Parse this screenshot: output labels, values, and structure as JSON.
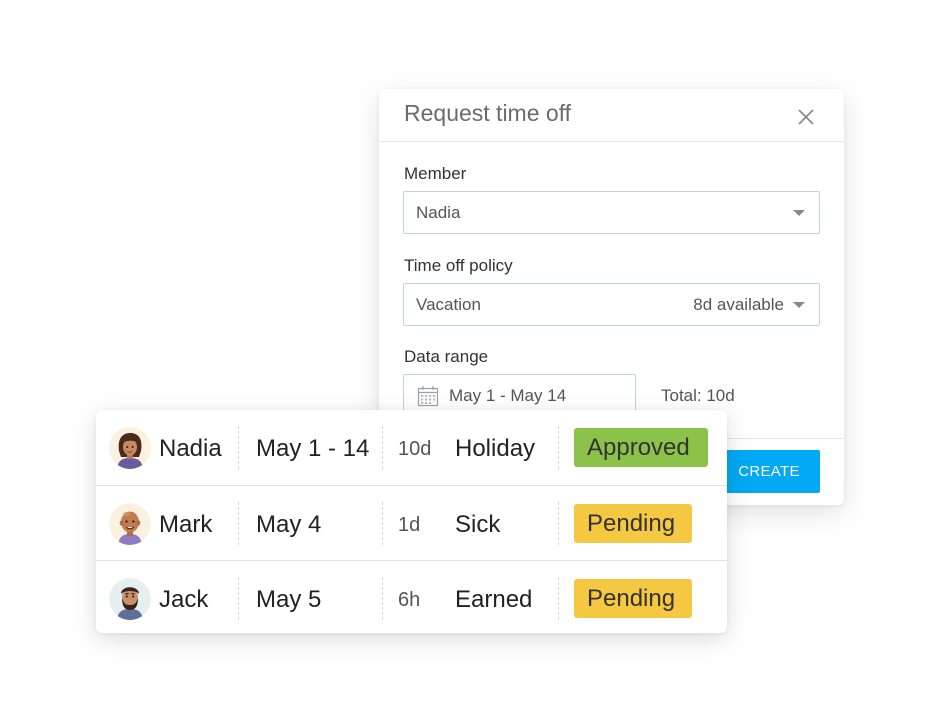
{
  "dialog": {
    "title": "Request time off",
    "member": {
      "label": "Member",
      "value": "Nadia"
    },
    "policy": {
      "label": "Time off policy",
      "value": "Vacation",
      "available": "8d available"
    },
    "date_range": {
      "label": "Data range",
      "value": "May 1 - May 14",
      "total": "Total: 10d"
    },
    "create_label": "CREATE",
    "accent_color": "#03a9f4"
  },
  "requests": [
    {
      "name": "Nadia",
      "dates": "May 1 - 14",
      "duration": "10d",
      "type": "Holiday",
      "status": "Approved",
      "status_color": "#8bc34a"
    },
    {
      "name": "Mark",
      "dates": "May 4",
      "duration": "1d",
      "type": "Sick",
      "status": "Pending",
      "status_color": "#f5c842"
    },
    {
      "name": "Jack",
      "dates": "May 5",
      "duration": "6h",
      "type": "Earned",
      "status": "Pending",
      "status_color": "#f5c842"
    }
  ]
}
